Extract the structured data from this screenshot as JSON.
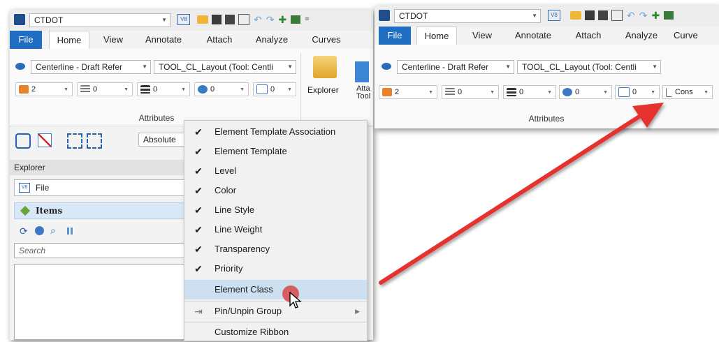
{
  "left_window": {
    "title": "CTDOT",
    "tabs": [
      "File",
      "Home",
      "View",
      "Annotate",
      "Attach",
      "Analyze",
      "Curves"
    ],
    "template_combo": "Centerline - Draft Refer",
    "tool_combo": "TOOL_CL_Layout (Tool: Centli",
    "attr_values": [
      "2",
      "0",
      "0",
      "0",
      "0"
    ],
    "attributes_label": "Attributes",
    "explorer_button": "Explorer",
    "attach_tools_button": "Atta\nTool",
    "absolute_label": "Absolute",
    "explorer_title": "Explorer",
    "file_item": "File",
    "items_header": "Items",
    "search_placeholder": "Search"
  },
  "context_menu": {
    "items": [
      {
        "label": "Element Template Association",
        "checked": true
      },
      {
        "label": "Element Template",
        "checked": true
      },
      {
        "label": "Level",
        "checked": true
      },
      {
        "label": "Color",
        "checked": true
      },
      {
        "label": "Line Style",
        "checked": true
      },
      {
        "label": "Line Weight",
        "checked": true
      },
      {
        "label": "Transparency",
        "checked": true
      },
      {
        "label": "Priority",
        "checked": true
      },
      {
        "label": "Element Class",
        "checked": false,
        "highlighted": true
      },
      {
        "label": "Pin/Unpin Group",
        "checked": false,
        "submenu": true
      },
      {
        "label": "Customize Ribbon",
        "checked": false
      }
    ]
  },
  "right_window": {
    "title": "CTDOT",
    "tabs": [
      "File",
      "Home",
      "View",
      "Annotate",
      "Attach",
      "Analyze",
      "Curve"
    ],
    "template_combo": "Centerline - Draft Refer",
    "tool_combo": "TOOL_CL_Layout (Tool: Centli",
    "attr_values": [
      "2",
      "0",
      "0",
      "0",
      "0",
      "Cons"
    ],
    "attributes_label": "Attributes"
  },
  "colors": {
    "file_tab": "#1f6ec1",
    "highlight": "#cde0f2",
    "arrow": "#e5312f",
    "items_bar": "#d9e8f7"
  }
}
